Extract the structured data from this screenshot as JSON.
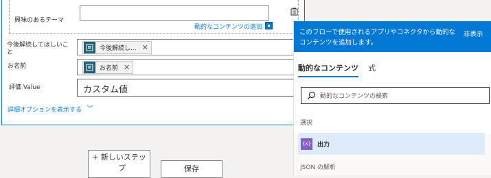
{
  "fields": {
    "theme_label": "興味のあるテーマ",
    "add_dynamic_link": "動的なコンテンツの追加",
    "improve_label": "今後解続してほしいこと",
    "improve_token": "今後解続し...",
    "name_label": "お名前",
    "name_token": "お名前",
    "rating_label": "評価 Value",
    "rating_value": "カスタム値",
    "advanced_link": "詳細オプションを表示する"
  },
  "buttons": {
    "new_step_line1": "+ 新しいステッ",
    "new_step_line2": "プ",
    "save": "保存"
  },
  "panel": {
    "header_text": "このフローで使用されるアプリやコネクタから動的なコンテンツを追加します。",
    "hide": "非表示",
    "tabs": [
      "動的なコンテンツ",
      "式"
    ],
    "search_placeholder": "動的なコンテンツの検索",
    "section_select": "選択",
    "output_item": "出力",
    "output_icon_glyph": "{x}",
    "section_json": "JSON の解析"
  },
  "colors": {
    "accent": "#0078d4",
    "token_icon": "#1f5f78",
    "output_icon": "#8661c5",
    "selected_row": "#deecf9"
  }
}
